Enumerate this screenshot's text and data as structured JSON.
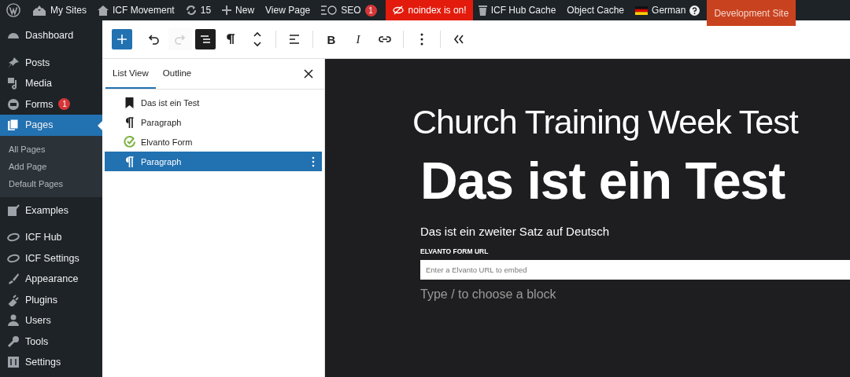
{
  "admin_bar": {
    "items": [
      {
        "kind": "wordpress"
      },
      {
        "kind": "sites",
        "label": "My Sites"
      },
      {
        "kind": "home",
        "label": "ICF Movement"
      },
      {
        "kind": "updates",
        "label": "15"
      },
      {
        "kind": "new",
        "label": "New"
      },
      {
        "kind": "text",
        "label": "View Page"
      },
      {
        "kind": "seo",
        "label": "SEO",
        "badge": "1"
      },
      {
        "kind": "alert",
        "label": "noindex is on!"
      },
      {
        "kind": "cache",
        "label": "ICF Hub Cache"
      },
      {
        "kind": "text",
        "label": "Object Cache"
      },
      {
        "kind": "language",
        "label": "German"
      },
      {
        "kind": "environment",
        "label": "Development Site"
      }
    ]
  },
  "sidebar": {
    "items": [
      {
        "kind": "dashboard",
        "label": "Dashboard",
        "selected": false
      },
      {
        "kind": "posts",
        "label": "Posts",
        "selected": false
      },
      {
        "kind": "media",
        "label": "Media",
        "selected": false
      },
      {
        "kind": "forms",
        "label": "Forms",
        "badge": "1",
        "selected": false
      },
      {
        "kind": "pages",
        "label": "Pages",
        "selected": true,
        "children": [
          {
            "label": "All Pages"
          },
          {
            "label": "Add Page"
          },
          {
            "label": "Default Pages"
          }
        ]
      },
      {
        "kind": "examples",
        "label": "Examples",
        "selected": false
      },
      {
        "kind": "hub",
        "label": "ICF Hub",
        "selected": false
      },
      {
        "kind": "hub",
        "label": "ICF Settings",
        "selected": false
      },
      {
        "kind": "appearance",
        "label": "Appearance",
        "selected": false
      },
      {
        "kind": "plugins",
        "label": "Plugins",
        "selected": false
      },
      {
        "kind": "users",
        "label": "Users",
        "selected": false
      },
      {
        "kind": "tools",
        "label": "Tools",
        "selected": false
      },
      {
        "kind": "settings",
        "label": "Settings",
        "selected": false
      }
    ]
  },
  "toolbar": {
    "buttons": [
      {
        "kind": "add",
        "selected": true,
        "disabled": false
      },
      {
        "kind": "undo",
        "selected": false,
        "disabled": false
      },
      {
        "kind": "redo",
        "selected": false,
        "disabled": true
      },
      {
        "kind": "list-view",
        "selected": true,
        "disabled": false
      },
      {
        "kind": "paragraph",
        "selected": false,
        "disabled": false
      },
      {
        "kind": "move",
        "selected": false,
        "disabled": false
      },
      {
        "kind": "separator"
      },
      {
        "kind": "align",
        "selected": false,
        "disabled": false
      },
      {
        "kind": "separator"
      },
      {
        "kind": "bold",
        "label": "B",
        "selected": false,
        "disabled": false
      },
      {
        "kind": "italic",
        "label": "I",
        "selected": false,
        "disabled": false
      },
      {
        "kind": "link",
        "selected": false,
        "disabled": false
      },
      {
        "kind": "separator"
      },
      {
        "kind": "more",
        "selected": false,
        "disabled": false
      },
      {
        "kind": "separator"
      },
      {
        "kind": "collapse",
        "selected": false,
        "disabled": false
      }
    ]
  },
  "list_view": {
    "tabs": [
      {
        "label": "List View",
        "selected": true
      },
      {
        "label": "Outline",
        "selected": false
      }
    ],
    "blocks": [
      {
        "kind": "heading",
        "label": "Das ist ein Test",
        "selected": false
      },
      {
        "kind": "paragraph",
        "label": "Paragraph",
        "selected": false
      },
      {
        "kind": "elvanto",
        "label": "Elvanto Form",
        "selected": false
      },
      {
        "kind": "paragraph",
        "label": "Paragraph",
        "selected": true
      }
    ]
  },
  "canvas": {
    "site_title": "Church Training Week Test",
    "heading": "Das ist ein Test",
    "paragraph": "Das ist ein zweiter Satz auf Deutsch",
    "form": {
      "label": "ELVANTO FORM URL",
      "placeholder": "Enter a Elvanto URL to embed"
    },
    "appender": "Type / to choose a block"
  }
}
